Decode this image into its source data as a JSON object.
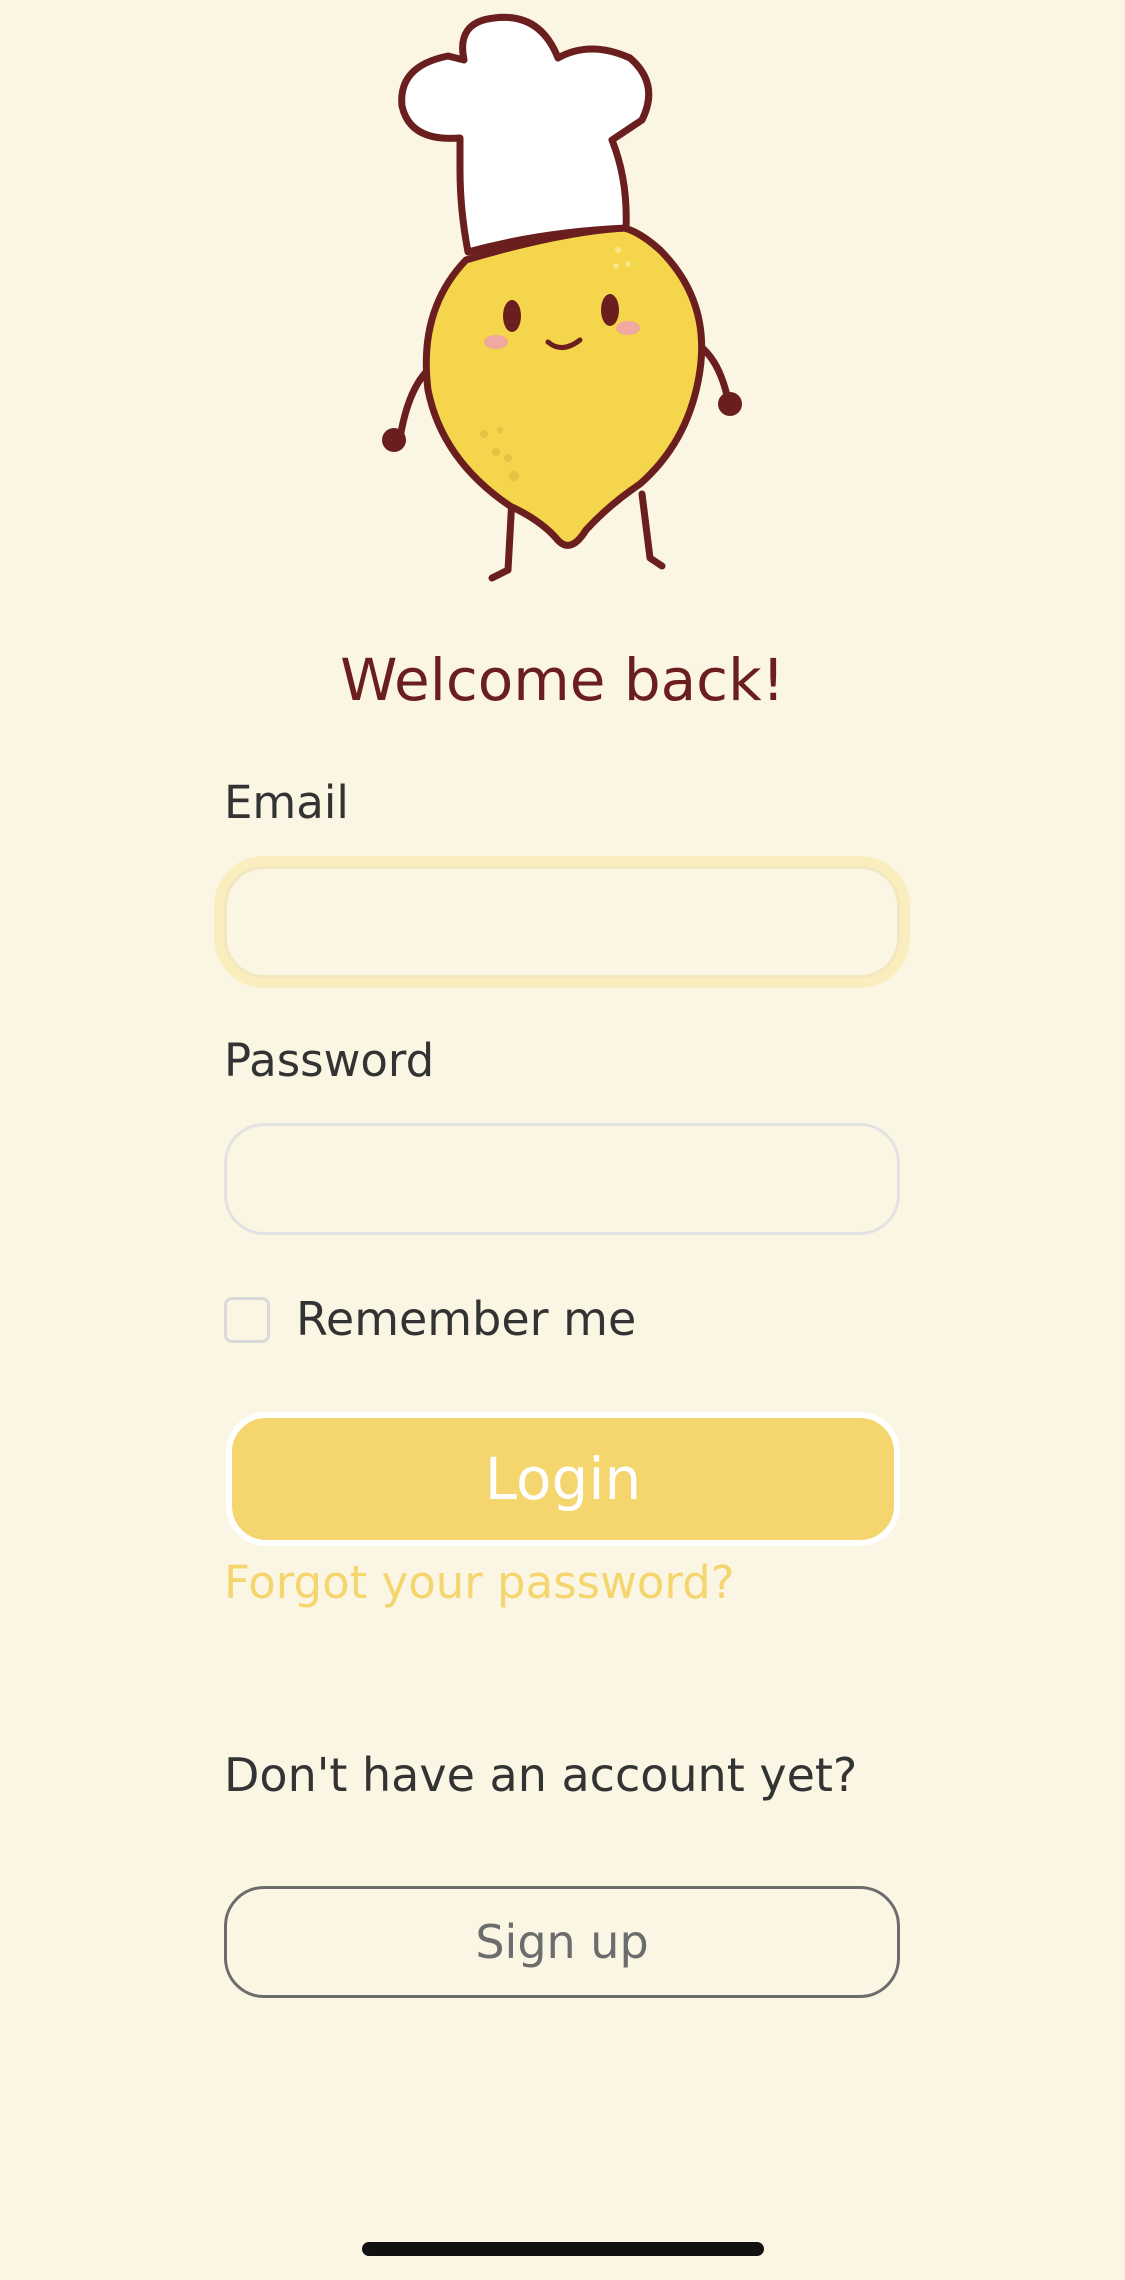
{
  "header": {
    "mascot": "chef-lemon-mascot",
    "title": "Welcome back!"
  },
  "form": {
    "email_label": "Email",
    "email_value": "",
    "password_label": "Password",
    "password_value": "",
    "remember_label": "Remember me",
    "remember_checked": false,
    "login_label": "Login",
    "forgot_label": "Forgot your password?"
  },
  "signup": {
    "prompt": "Don't have an account yet?",
    "button_label": "Sign up"
  },
  "colors": {
    "background": "#FBF6E4",
    "accent": "#F4D56E",
    "title": "#6B1E1E",
    "text": "#333333"
  }
}
